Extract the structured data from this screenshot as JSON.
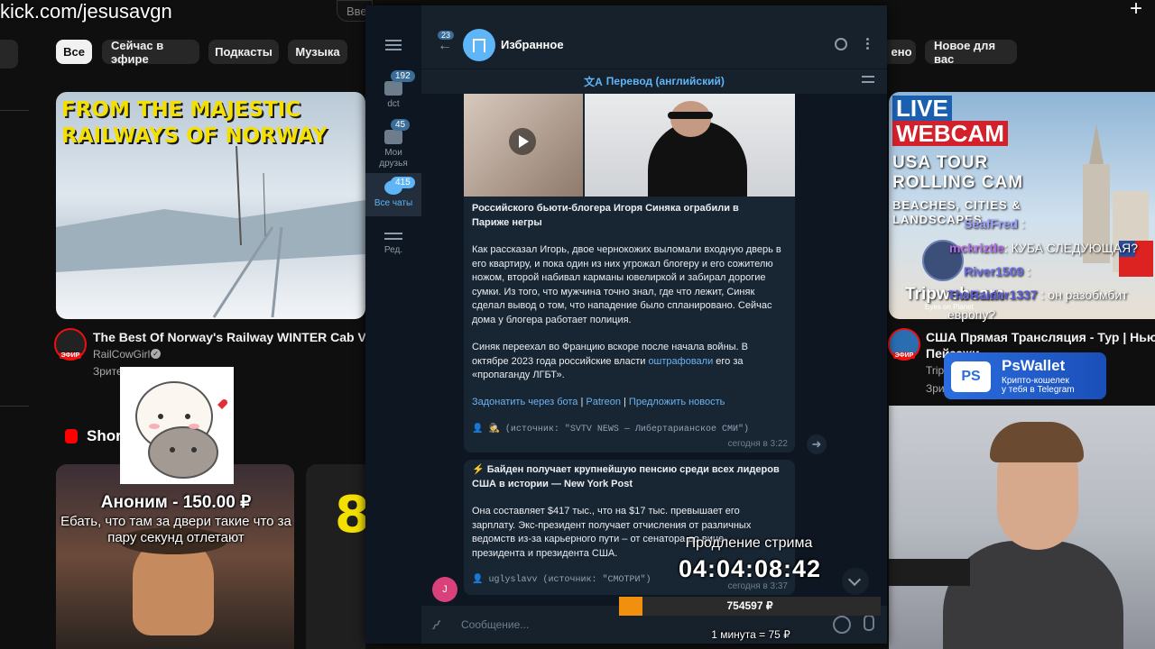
{
  "browser": {
    "url": "kick.com/jesusavgn",
    "search_fragment": "Вве"
  },
  "youtube": {
    "chips": [
      "Все",
      "Сейчас в эфире",
      "Подкасты",
      "Музыка",
      "ено",
      "Новое для вас"
    ],
    "video1": {
      "thumb_text": "FROM THE MAJESTIC RAILWAYS OF NORWAY",
      "title": "The Best Of Norway's Railway WINTER Cab Views",
      "channel": "RailCowGirl",
      "meta": "Зрите",
      "badge": "ЭФИР"
    },
    "video2": {
      "thumb_text_1": "LIVE",
      "thumb_text_2": "WEBCAM",
      "thumb_text_3": "USA TOUR ROLLING CAM",
      "thumb_text_4": "BEACHES, CITIES & LANDSCAPES",
      "title": "США Прямая Трансляция - Тур | Нью-Йо",
      "title2": "Пейзажи",
      "channel": "Trip",
      "meta": "Зри",
      "badge": "ЭФИР"
    },
    "shorts_label": "Shor",
    "shorts_number": "8"
  },
  "telegram": {
    "title": "Избранное",
    "back_badge": "23",
    "translate": "Перевод (английский)",
    "folders": [
      {
        "label": "dct",
        "badge": "192"
      },
      {
        "label": "Мои друзья",
        "badge": "45"
      },
      {
        "label": "Все чаты",
        "badge": "415"
      },
      {
        "label": "Ред.",
        "badge": ""
      }
    ],
    "msg1": {
      "headline": "Российского бьюти-блогера Игоря Синяка ограбили в Париже негры",
      "p1": "Как рассказал Игорь, двое чернокожих выломали входную дверь в его квартиру, и пока один из них угрожал блогеру и его сожителю ножом, второй набивал карманы ювелиркой и забирал дорогие сумки. Из того, что мужчина точно знал, где что лежит, Синяк сделал вывод о том, что нападение было спланировано. Сейчас дома у блогера работает полиция.",
      "p2_a": "Синяк переехал во Францию вскоре после начала войны. В октябре 2023 года российские власти ",
      "p2_link": "оштрафовали",
      "p2_b": " его за «пропаганду ЛГБТ».",
      "link1": "Задонатить через бота",
      "link2": "Patreon",
      "link3": "Предложить новость",
      "source": "👤 🕵 (источник: \"SVTV NEWS — Либертарианское СМИ\")",
      "time": "сегодня в 3:22"
    },
    "msg2": {
      "headline": "⚡ Байден получает крупнейшую пенсию среди всех лидеров США в истории — New York Post",
      "p1": "Она составляет $417 тыс., что на $17 тыс. превышает его зарплату. Экс-президент получает отчисления от различных ведомств из-за карьерного пути – от сенатора до вице-президента и президента США.",
      "source": "👤 uglyslavv (источник: \"СМОТРИ\")",
      "time": "сегодня в 3:37",
      "avatar_letter": "J"
    },
    "input_placeholder": "Сообщение..."
  },
  "overlay": {
    "donation_name": "Аноним - 150.00 ₽",
    "donation_text": "Ебать, что там за двери такие что за пару секунд отлетают",
    "extension_label": "Продление стрима",
    "timer": "04:04:08:42",
    "progress_amount": "754597 ₽",
    "progress_fraction": 0.09,
    "rate": "1 минута = 75 ₽",
    "chat": [
      {
        "user": "SeafFred",
        "text": ":"
      },
      {
        "user": "mckriztle",
        "text": ": КУБА СЛЕДУЮЩАЯ?"
      },
      {
        "user": "River1509",
        "text": ":"
      },
      {
        "user": "TheRaider1337",
        "text": ": он разобмбит"
      },
      {
        "user": "",
        "text": "европу?"
      }
    ],
    "ad_title": "PsWallet",
    "ad_sub1": "Крипто-кошелек",
    "ad_sub2": "у тебя в Telegram",
    "ad_logo": "PS",
    "tripwebcam": "Tripwebcam",
    "tripwebcam_sub": "Eyes on Planet"
  }
}
